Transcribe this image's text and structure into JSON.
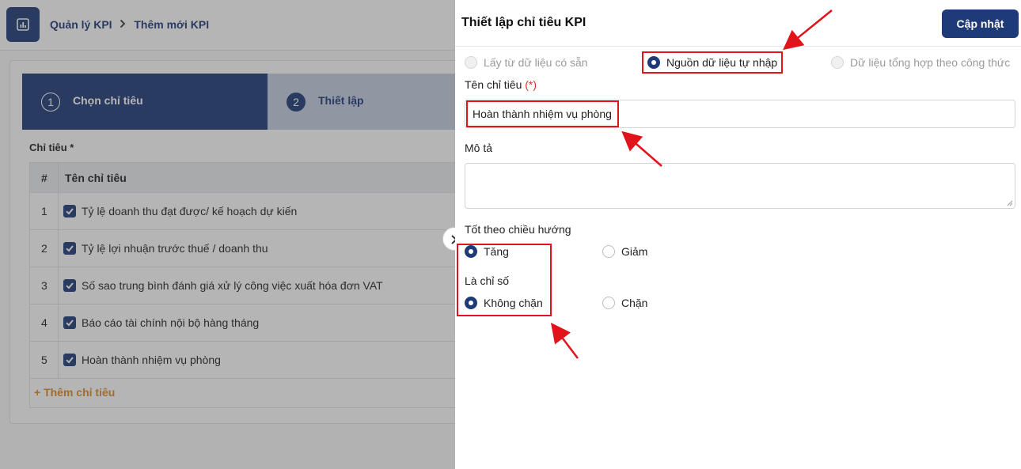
{
  "breadcrumb": {
    "root": "Quản lý KPI",
    "current": "Thêm mới KPI"
  },
  "steps": [
    {
      "number": "1",
      "label": "Chọn chỉ tiêu"
    },
    {
      "number": "2",
      "label": "Thiết lập"
    }
  ],
  "kpi_table": {
    "section_label": "Chỉ tiêu *",
    "columns": [
      "#",
      "Tên chỉ tiêu"
    ],
    "rows": [
      {
        "no": "1",
        "name": "Tỷ lệ doanh thu đạt được/ kế hoạch dự kiến",
        "checked": true
      },
      {
        "no": "2",
        "name": "Tỷ lệ lợi nhuận trước thuế / doanh thu",
        "checked": true
      },
      {
        "no": "3",
        "name": "Số sao trung bình đánh giá xử lý công việc xuất hóa đơn VAT",
        "checked": true
      },
      {
        "no": "4",
        "name": "Báo cáo tài chính nội bộ hàng tháng",
        "checked": true
      },
      {
        "no": "5",
        "name": "Hoàn thành nhiệm vụ phòng",
        "checked": true
      }
    ],
    "add_label": "+ Thêm chỉ tiêu"
  },
  "drawer": {
    "title": "Thiết lập chỉ tiêu KPI",
    "update_button": "Cập nhật",
    "source_options": [
      {
        "label": "Lấy từ dữ liệu có sẵn",
        "state": "disabled"
      },
      {
        "label": "Nguồn dữ liệu tự nhập",
        "state": "selected"
      },
      {
        "label": "Dữ liệu tổng hợp theo công thức",
        "state": "disabled"
      }
    ],
    "name_label": "Tên chỉ tiêu",
    "required_mark": "(*)",
    "name_value": "Hoàn thành nhiệm vụ phòng",
    "description_label": "Mô tả",
    "description_value": "",
    "direction_label": "Tốt theo chiều hướng",
    "direction_options": [
      {
        "label": "Tăng",
        "state": "selected"
      },
      {
        "label": "Giảm",
        "state": "unselected"
      }
    ],
    "cap_label": "Là chỉ số",
    "cap_options": [
      {
        "label": "Không chặn",
        "state": "selected"
      },
      {
        "label": "Chặn",
        "state": "unselected"
      }
    ]
  },
  "colors": {
    "primary": "#1f3a78",
    "accent_orange": "#e08a1e",
    "annotation_red": "#e0141a",
    "required_red": "#d9302c"
  },
  "icons": {
    "app": "bar-chart-icon",
    "breadcrumb_separator": "chevron-right-icon",
    "drawer_toggle": "chevron-right-icon",
    "checkbox": "check-icon"
  }
}
